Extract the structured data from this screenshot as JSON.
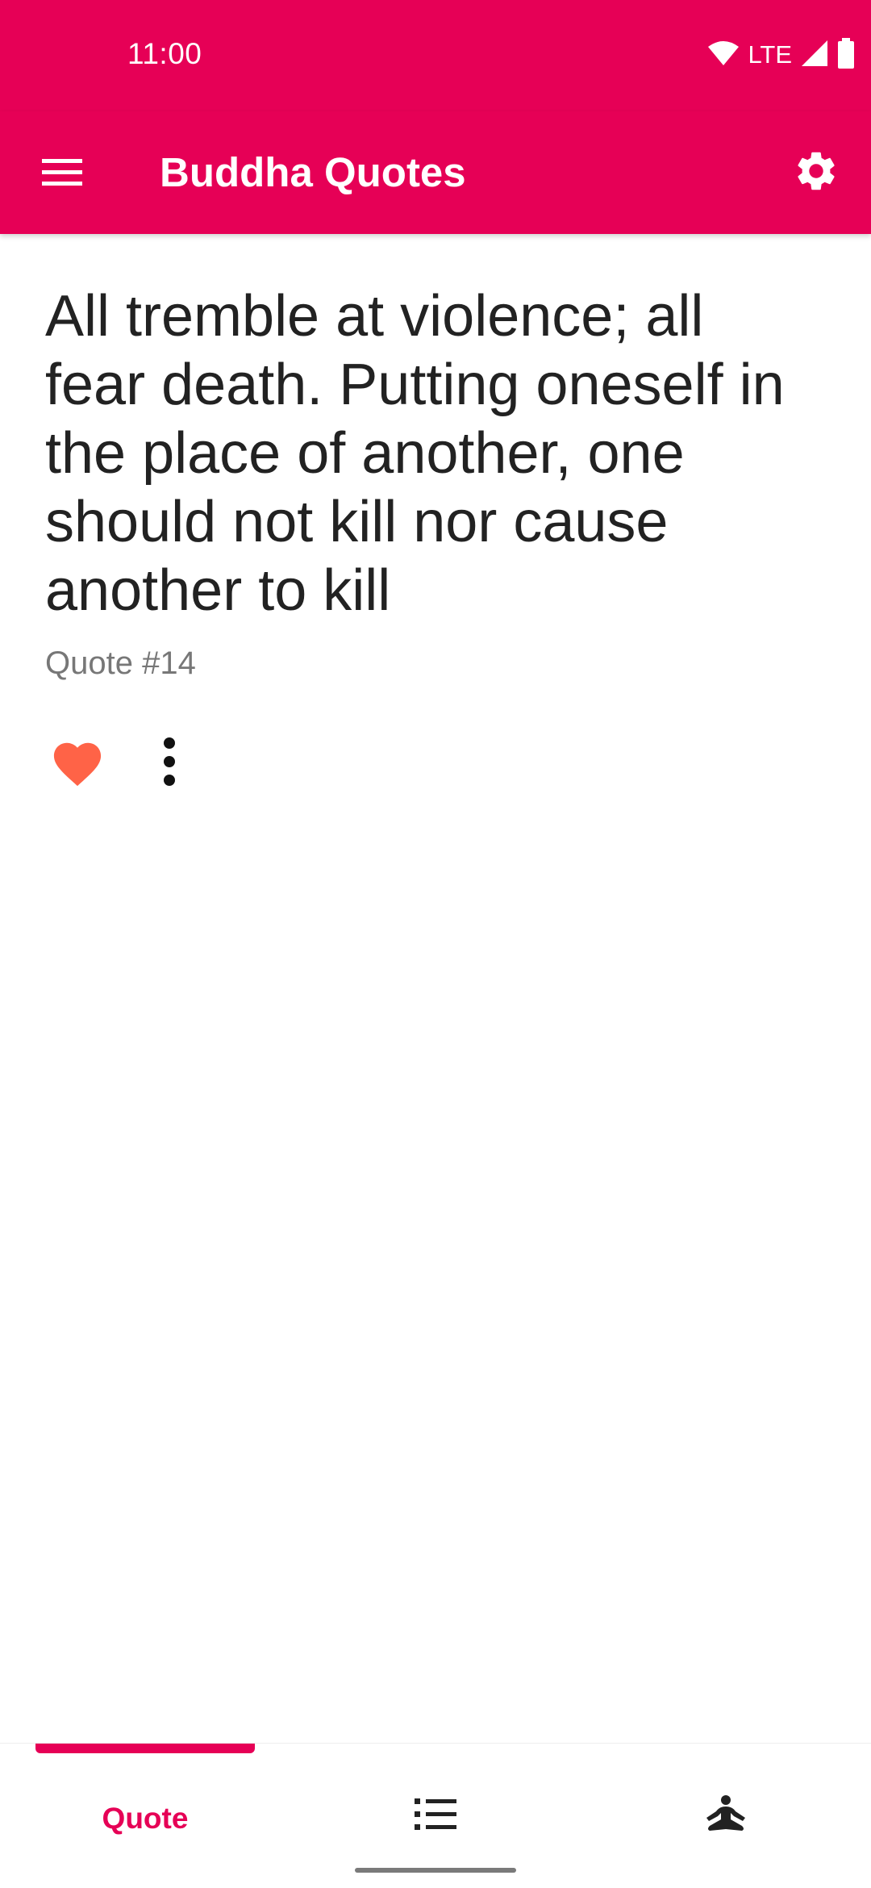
{
  "status_bar": {
    "time": "11:00",
    "network": "LTE"
  },
  "app_bar": {
    "title": "Buddha Quotes",
    "menu_icon": "menu-icon",
    "settings_icon": "gear-icon"
  },
  "quote": {
    "text": "All tremble at violence; all fear death. Putting oneself in the place of another, one should not kill nor cause another to kill",
    "number": "Quote #14",
    "favorite_icon": "heart-icon",
    "more_icon": "more-vertical-icon"
  },
  "bottom_nav": {
    "tabs": [
      {
        "label": "Quote",
        "selected": true
      },
      {
        "icon": "list-icon",
        "selected": false
      },
      {
        "icon": "meditation-icon",
        "selected": false
      }
    ]
  },
  "colors": {
    "primary": "#e60056",
    "heart": "#ff6347",
    "text": "#222222",
    "secondary_text": "#777777"
  }
}
